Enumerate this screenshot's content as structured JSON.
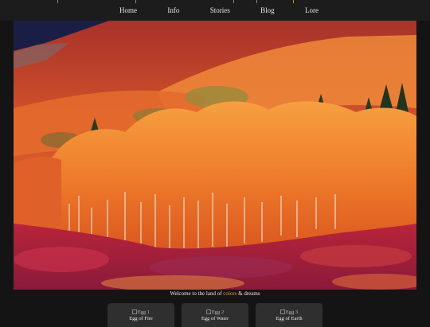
{
  "nav": {
    "items": [
      {
        "label": "Home"
      },
      {
        "label": "Info"
      },
      {
        "label": "Stories"
      },
      {
        "label": "Blog"
      },
      {
        "label": "Lore"
      }
    ]
  },
  "hero": {
    "alt": "Autumn aspen forest on a hillside"
  },
  "caption": {
    "before": "Welcome to the land of ",
    "highlight": "colors",
    "after": " & dreams"
  },
  "eggs": [
    {
      "image_alt": "Egg 1",
      "name": "Egg of Fire"
    },
    {
      "image_alt": "Egg 2",
      "name": "Egg of Water"
    },
    {
      "image_alt": "Egg 3",
      "name": "Egg of Earth"
    }
  ],
  "colors": {
    "background": "#141414",
    "nav_bg": "#1c1c1c",
    "card_bg": "#2f2f2f",
    "accent": "#e0a030"
  }
}
